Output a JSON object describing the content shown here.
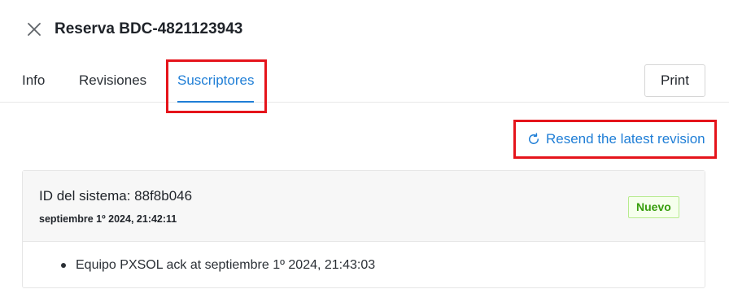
{
  "header": {
    "title": "Reserva BDC-4821123943",
    "close_icon": "close-icon"
  },
  "tabs": [
    {
      "label": "Info",
      "active": false
    },
    {
      "label": "Revisiones",
      "active": false
    },
    {
      "label": "Suscriptores",
      "active": true
    }
  ],
  "toolbar": {
    "print_label": "Print",
    "resend_label": "Resend the latest revision",
    "resend_icon": "refresh-icon"
  },
  "subscriber": {
    "system_id": "ID del sistema: 88f8b046",
    "date": "septiembre 1º 2024, 21:42:11",
    "status_badge": "Nuevo",
    "events": [
      "Equipo PXSOL ack at septiembre 1º 2024, 21:43:03"
    ]
  },
  "colors": {
    "accent": "#1f7ed6",
    "highlight": "#e5141b",
    "badge_text": "#389e0d",
    "badge_bg": "#f6ffed"
  }
}
